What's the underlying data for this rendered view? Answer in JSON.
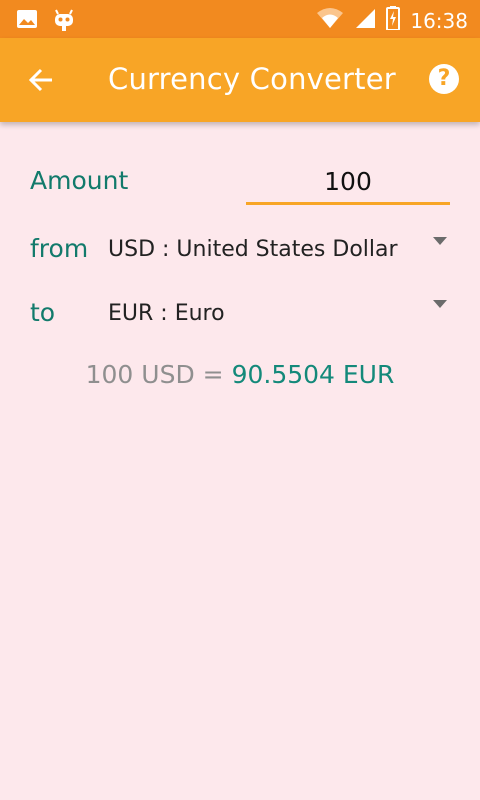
{
  "status_bar": {
    "time": "16:38",
    "icons": [
      "image-icon",
      "android-debug-icon",
      "wifi-icon",
      "signal-icon",
      "battery-charging-icon"
    ]
  },
  "app_bar": {
    "title": "Currency Converter",
    "back_icon": "arrow-back-icon",
    "help_icon": "help-icon"
  },
  "form": {
    "amount_label": "Amount",
    "amount_value": "100",
    "from_label": "from",
    "from_value": "USD : United States Dollar",
    "to_label": "to",
    "to_value": "EUR : Euro"
  },
  "result": {
    "from_text": "100 USD =",
    "to_text": "90.5504 EUR"
  },
  "colors": {
    "status_bar": "#f28a1f",
    "app_bar": "#f8a526",
    "background": "#fde8ec",
    "label": "#127a6b",
    "result_value": "#14897a"
  }
}
